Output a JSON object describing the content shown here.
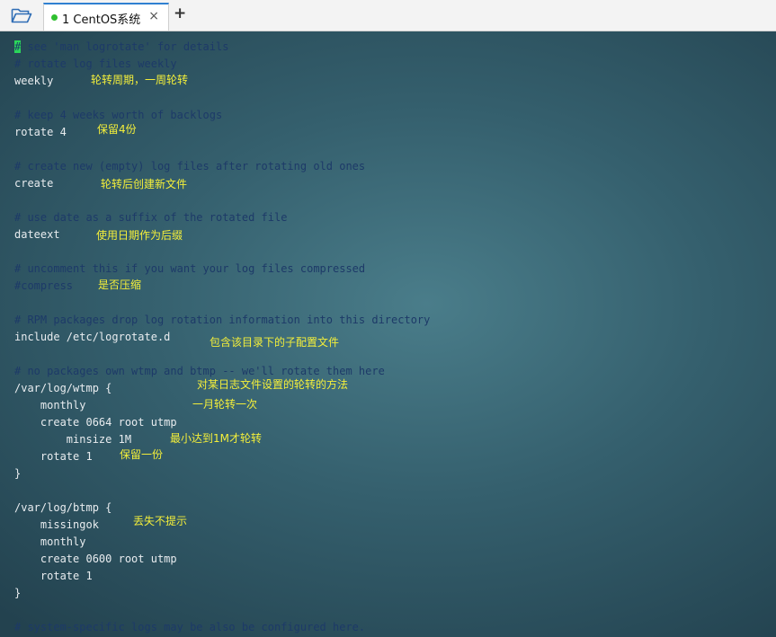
{
  "tabbar": {
    "folder_icon": "folder-open-icon",
    "tab_label": "1 CentOS系统",
    "close_glyph": "×",
    "add_glyph": "+"
  },
  "terminal": {
    "lines": [
      {
        "text": "see 'man logrotate' for details",
        "cursor": "#"
      },
      {
        "text": "# rotate log files weekly"
      },
      {
        "text": "weekly"
      },
      {
        "text": "# keep 4 weeks worth of backlogs"
      },
      {
        "text": "rotate 4"
      },
      {
        "text": "# create new (empty) log files after rotating old ones"
      },
      {
        "text": "create"
      },
      {
        "text": "# use date as a suffix of the rotated file"
      },
      {
        "text": "dateext"
      },
      {
        "text": "# uncomment this if you want your log files compressed"
      },
      {
        "text": "#compress"
      },
      {
        "text": "# RPM packages drop log rotation information into this directory"
      },
      {
        "text": "include /etc/logrotate.d"
      },
      {
        "text": "# no packages own wtmp and btmp -- we'll rotate them here"
      },
      {
        "text": "/var/log/wtmp {"
      },
      {
        "text": "    monthly"
      },
      {
        "text": "    create 0664 root utmp"
      },
      {
        "text": "        minsize 1M"
      },
      {
        "text": "    rotate 1"
      },
      {
        "text": "}"
      },
      {
        "text": "/var/log/btmp {"
      },
      {
        "text": "    missingok"
      },
      {
        "text": "    monthly"
      },
      {
        "text": "    create 0600 root utmp"
      },
      {
        "text": "    rotate 1"
      },
      {
        "text": "}"
      },
      {
        "text": "# system-specific logs may be also be configured here."
      }
    ],
    "annotations": [
      "轮转周期，一周轮转",
      "保留4份",
      "轮转后创建新文件",
      "使用日期作为后缀",
      "是否压缩",
      "包含该目录下的子配置文件",
      "对某日志文件设置的轮转的方法",
      "一月轮转一次",
      "最小达到1M才轮转",
      "保留一份",
      "丢失不提示"
    ]
  }
}
